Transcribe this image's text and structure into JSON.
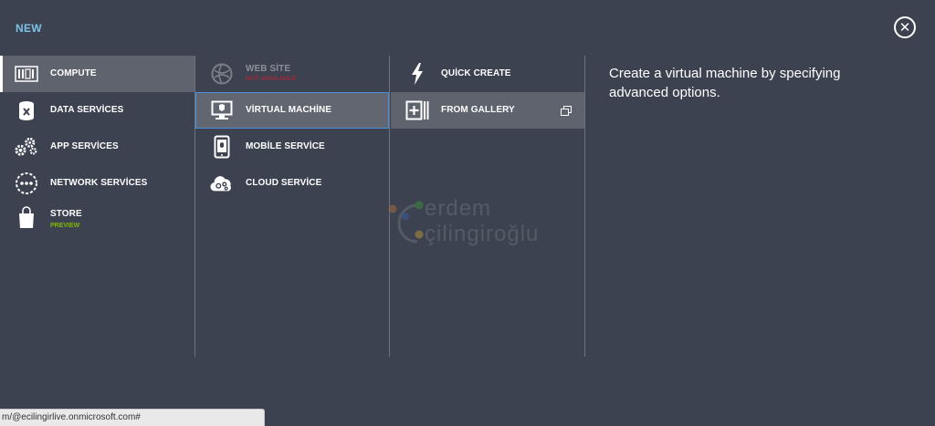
{
  "header": {
    "title": "NEW",
    "close_icon": "close-icon"
  },
  "categories": [
    {
      "label": "COMPUTE",
      "icon": "compute-icon",
      "selected": true
    },
    {
      "label": "DATA SERVİCES",
      "icon": "data-services-icon"
    },
    {
      "label": "APP SERVİCES",
      "icon": "gears-icon"
    },
    {
      "label": "NETWORK SERVİCES",
      "icon": "network-icon"
    },
    {
      "label": "STORE",
      "sub": "PREVIEW",
      "icon": "shopping-bag-icon"
    }
  ],
  "compute_items": [
    {
      "label": "WEB SİTE",
      "sub": "NOT AVAILABLE",
      "icon": "globe-icon",
      "disabled": true
    },
    {
      "label": "VİRTUAL MACHİNE",
      "icon": "monitor-icon",
      "selected": true
    },
    {
      "label": "MOBİLE SERVİCE",
      "icon": "mobile-icon"
    },
    {
      "label": "CLOUD SERVİCE",
      "icon": "cloud-icon"
    }
  ],
  "vm_options": [
    {
      "label": "QUİCK CREATE",
      "icon": "lightning-icon"
    },
    {
      "label": "FROM GALLERY",
      "icon": "gallery-icon",
      "selected": true,
      "action_icon": "open-window-icon"
    }
  ],
  "description": "Create a virtual machine by specifying advanced options.",
  "watermark": {
    "line1": "erdem",
    "line2": "çilingiroğlu"
  },
  "status_bar": {
    "url": "m/@ecilingirlive.onmicrosoft.com#"
  },
  "colors": {
    "background": "#3c4250",
    "accent": "#7dc3e8",
    "preview": "#7fba00",
    "selected": "#5e636e"
  }
}
